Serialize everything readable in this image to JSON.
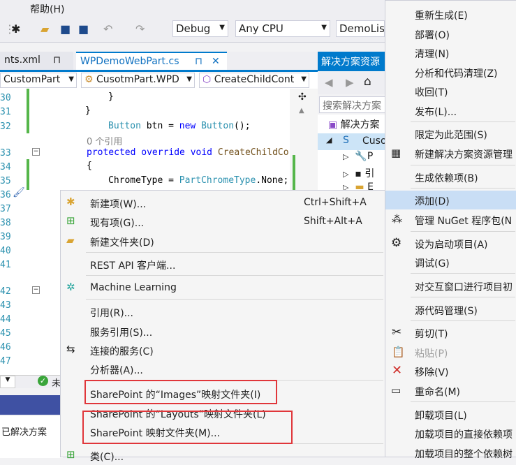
{
  "menubar": {
    "help": "帮助(H)"
  },
  "toolbar": {
    "config": "Debug",
    "platform": "Any CPU",
    "project": "DemoLis"
  },
  "tabs": [
    {
      "label": "nts.xml",
      "pin": "⊓"
    },
    {
      "label": "WPDemoWebPart.cs",
      "pin": "⊓",
      "close": "✕"
    }
  ],
  "nav": {
    "project": "CustomPart",
    "class": "CusotmPart.WPD",
    "member": "CreateChildCont"
  },
  "code": {
    "line_numbers": [
      "30",
      "31",
      "32",
      "33",
      "34",
      "35",
      "36",
      "37",
      "38",
      "39",
      "40",
      "41",
      "42",
      "43",
      "44",
      "45",
      "46",
      "47"
    ],
    "brace1": "}",
    "brace2": "}",
    "button_line": {
      "type": "Button",
      "var": " btn = ",
      "kw": "new",
      "type2": " Button",
      "tail": "();"
    },
    "refs": "0 个引用",
    "method_line": {
      "kw": "protected override void",
      "name": " CreateChildCo"
    },
    "open_brace": "{",
    "chrome_line": {
      "a": "ChromeType = ",
      "b": "PartChromeType",
      "c": ".None;"
    }
  },
  "status": {
    "prefix": "未"
  },
  "lower_panel_text": "已解决方案",
  "solution_explorer": {
    "title": "解决方案资源",
    "search_placeholder": "搜索解决方案",
    "tree": [
      {
        "text": "解决方案"
      },
      {
        "text": "Cuso"
      },
      {
        "text": "P"
      },
      {
        "text": "引"
      },
      {
        "text": "E"
      }
    ]
  },
  "right_menu": {
    "items": [
      {
        "label": "重新生成(E)"
      },
      {
        "label": "部署(O)"
      },
      {
        "label": "清理(N)"
      },
      {
        "label": "分析和代码清理(Z)"
      },
      {
        "label": "收回(T)"
      },
      {
        "label": "发布(L)..."
      },
      {
        "label": "限定为此范围(S)"
      },
      {
        "label": "新建解决方案资源管理"
      },
      {
        "label": "生成依赖项(B)"
      },
      {
        "label": "添加(D)"
      },
      {
        "label": "管理 NuGet 程序包(N"
      },
      {
        "label": "设为启动项目(A)"
      },
      {
        "label": "调试(G)"
      },
      {
        "label": "对交互窗口进行项目初"
      },
      {
        "label": "源代码管理(S)"
      },
      {
        "label": "剪切(T)"
      },
      {
        "label": "粘贴(P)"
      },
      {
        "label": "移除(V)"
      },
      {
        "label": "重命名(M)"
      },
      {
        "label": "卸载项目(L)"
      },
      {
        "label": "加载项目的直接依赖项"
      },
      {
        "label": "加载项目的整个依赖树"
      }
    ]
  },
  "add_menu": {
    "items": [
      {
        "label": "新建项(W)...",
        "shortcut": "Ctrl+Shift+A"
      },
      {
        "label": "现有项(G)...",
        "shortcut": "Shift+Alt+A"
      },
      {
        "label": "新建文件夹(D)"
      },
      {
        "label": "REST API 客户端..."
      },
      {
        "label": "Machine Learning"
      },
      {
        "label": "引用(R)..."
      },
      {
        "label": "服务引用(S)..."
      },
      {
        "label": "连接的服务(C)"
      },
      {
        "label": "分析器(A)..."
      },
      {
        "label": "SharePoint 的“Images”映射文件夹(I)"
      },
      {
        "label": "SharePoint 的“Layouts”映射文件夹(L)"
      },
      {
        "label": "SharePoint 映射文件夹(M)..."
      },
      {
        "label": "类(C)..."
      }
    ]
  },
  "colors": {
    "accent": "#007acc",
    "highlight": "#c9def5",
    "callout": "#e0363a"
  }
}
